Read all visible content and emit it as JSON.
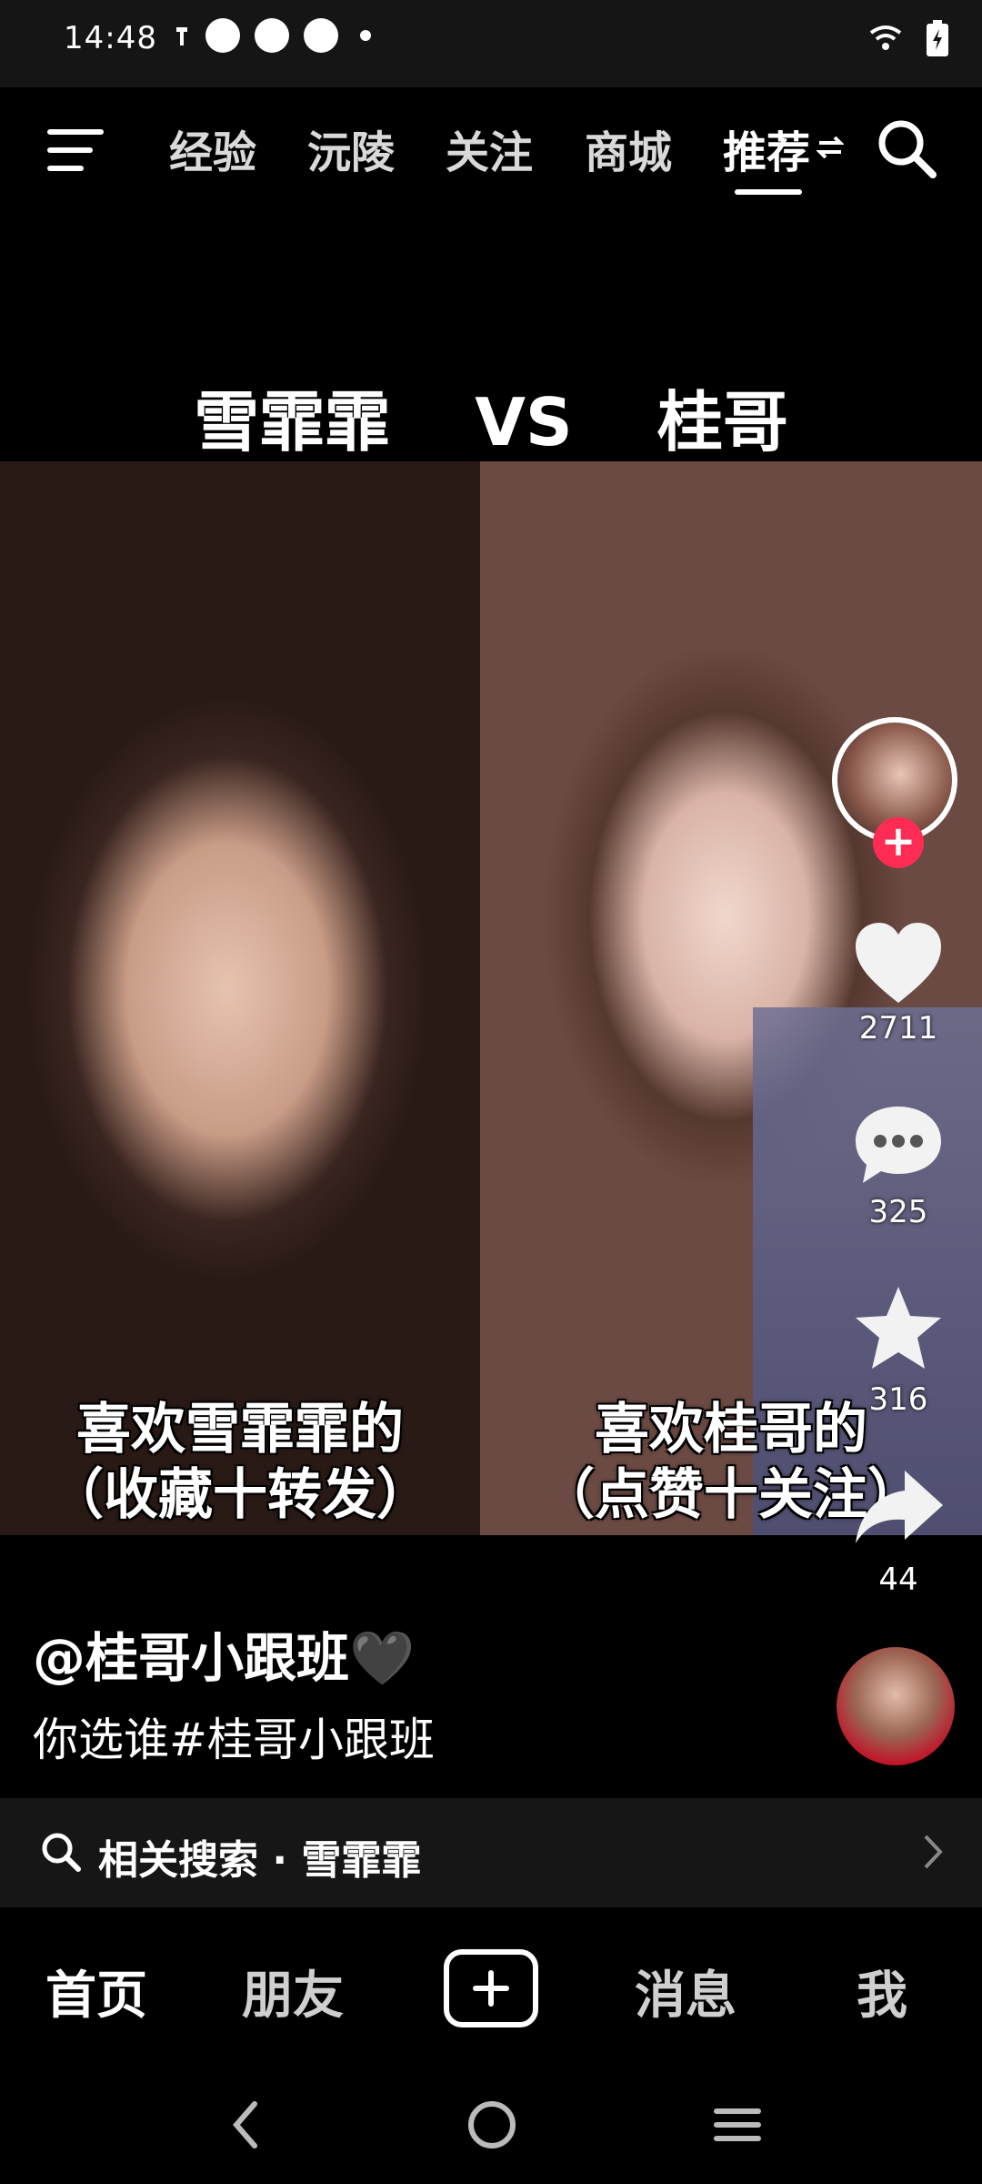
{
  "status_bar": {
    "time": "14:48"
  },
  "top_nav": {
    "tabs": [
      {
        "label": "经验"
      },
      {
        "label": "沅陵"
      },
      {
        "label": "关注"
      },
      {
        "label": "商城"
      },
      {
        "label": "推荐"
      }
    ],
    "active_tab": "推荐"
  },
  "video": {
    "title_left": "雪霏霏",
    "title_vs": "VS",
    "title_right": "桂哥",
    "caption_left_line1": "喜欢雪霏霏的",
    "caption_left_line2": "（收藏十转发）",
    "caption_right_line1": "喜欢桂哥的",
    "caption_right_line2": "（点赞十关注）"
  },
  "rail": {
    "likes": "2711",
    "comments": "325",
    "favorites": "316",
    "shares": "44"
  },
  "post": {
    "author": "@桂哥小跟班🖤",
    "description": "你选谁#桂哥小跟班"
  },
  "related_search": {
    "label": "相关搜索 · 雪霏霏"
  },
  "bottom_nav": {
    "home": "首页",
    "friends": "朋友",
    "messages": "消息",
    "me": "我"
  },
  "colors": {
    "accent": "#fe2c55",
    "background": "#000000"
  }
}
